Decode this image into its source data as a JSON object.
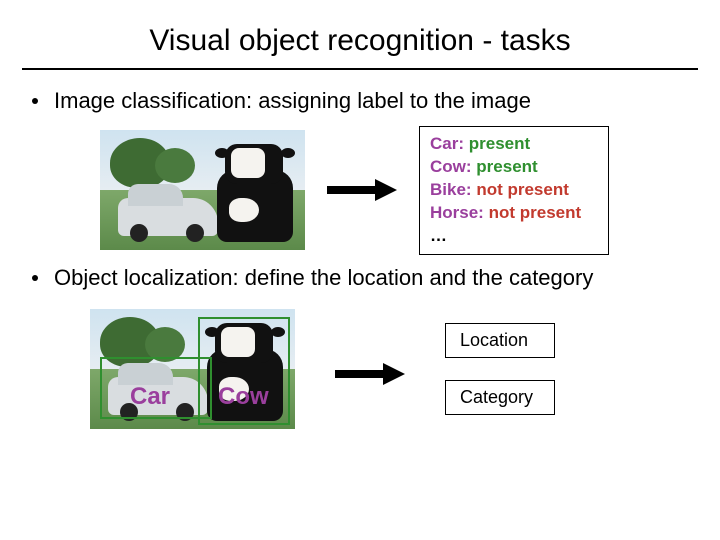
{
  "title": "Visual object recognition - tasks",
  "bullets": {
    "classification": "Image classification: assigning label to the image",
    "localization": "Object localization: define the location and the category"
  },
  "labels_box": {
    "lines": [
      {
        "key": "Car:",
        "value": "present",
        "status": "present"
      },
      {
        "key": "Cow:",
        "value": "present",
        "status": "present"
      },
      {
        "key": "Bike:",
        "value": "not present",
        "status": "absent"
      },
      {
        "key": "Horse:",
        "value": "not present",
        "status": "absent"
      }
    ],
    "ellipsis": "…"
  },
  "bbox_labels": {
    "car": "Car",
    "cow": "Cow"
  },
  "right_boxes": {
    "location": "Location",
    "category": "Category"
  },
  "colors": {
    "key_purple": "#9a3f9d",
    "present_green": "#2f8f2f",
    "absent_red": "#c23a2e"
  }
}
